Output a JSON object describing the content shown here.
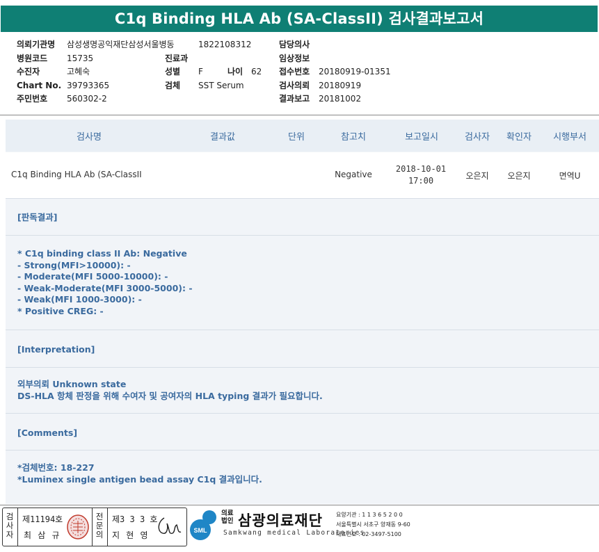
{
  "title": "C1q Binding HLA Ab (SA-ClassII) 검사결과보고서",
  "info": {
    "col1": [
      {
        "label": "의뢰기관명",
        "value": "삼성생명공익재단삼성서울병동"
      },
      {
        "label": "병원코드",
        "value": "15735"
      },
      {
        "label": "수진자",
        "value": "고혜숙"
      },
      {
        "label": "Chart No.",
        "value": "39793365"
      },
      {
        "label": "주민번호",
        "value": "560302-2"
      }
    ],
    "col2_code": "1822108312",
    "col2": [
      {
        "label": "진료과",
        "value": ""
      },
      {
        "label": "성별",
        "value": "F"
      },
      {
        "label": "검체",
        "value": "SST Serum"
      }
    ],
    "age_label": "나이",
    "age_value": "62",
    "col3": [
      {
        "label": "담당의사",
        "value": ""
      },
      {
        "label": "임상정보",
        "value": ""
      },
      {
        "label": "접수번호",
        "value": "20180919-01351"
      },
      {
        "label": "검사의뢰",
        "value": "20180919"
      },
      {
        "label": "결과보고",
        "value": "20181002"
      }
    ]
  },
  "table": {
    "headers": [
      "검사명",
      "결과값",
      "단위",
      "참고치",
      "보고일시",
      "검사자",
      "확인자",
      "시행부서"
    ],
    "row": {
      "test_name": "C1q Binding HLA Ab (SA-ClassII",
      "result": "",
      "unit": "",
      "reference": "Negative",
      "report_date": "2018-10-01",
      "report_time": "17:00",
      "tester": "오은지",
      "confirmer": "오은지",
      "department": "면역U"
    }
  },
  "sections": {
    "judgment_title": "[판독결과]",
    "judgment_lines": [
      "* C1q binding class II Ab: Negative",
      "- Strong(MFI>10000): -",
      "- Moderate(MFI 5000-10000): -",
      "- Weak-Moderate(MFI 3000-5000): -",
      "- Weak(MFI 1000-3000): -",
      "* Positive CREG: -"
    ],
    "interpretation_title": "[Interpretation]",
    "interpretation_lines": [
      "외부의뢰 Unknown state",
      "DS-HLA 항체 판정을 위해 수여자 및 공여자의 HLA typing 결과가 필요합니다."
    ],
    "comments_title": "[Comments]",
    "comments_lines": [
      "*검체번호: 18-227",
      "*Luminex single antigen bead assay C1q 결과입니다."
    ]
  },
  "footer": {
    "sig_label1": [
      "검",
      "사",
      "자"
    ],
    "license1": "제11194호",
    "name1": "최 삼 규",
    "sig_label2": [
      "전",
      "문",
      "의"
    ],
    "license2": "제3 3 3 호",
    "name2": "지 현 영",
    "logo_badge": "SML",
    "org_type": [
      "의료",
      "법인"
    ],
    "org_name": "삼광의료재단",
    "org_eng": "Samkwang medical Laboratories",
    "care_code": "요양기관 : 1 1 3 6 5 2 0 0",
    "address": "서울특별시 서초구 양재동 9-60",
    "phone": "대표번호 : 02-3497-5100",
    "colors": {
      "title_bg": "#0f7f74",
      "section_text": "#3a6a9e",
      "table_bg": "#f1f4f8",
      "logo_blue": "#1f86c6"
    }
  }
}
